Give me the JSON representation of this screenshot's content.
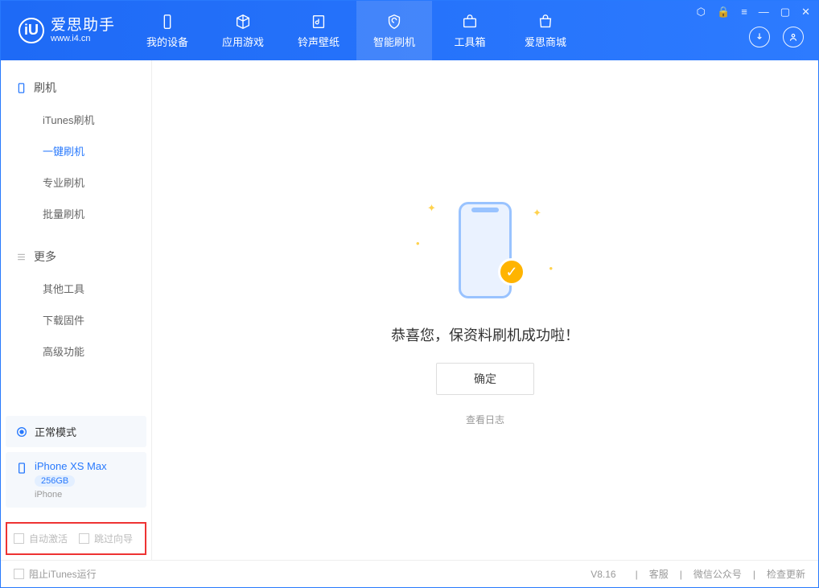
{
  "app": {
    "title": "爱思助手",
    "subtitle": "www.i4.cn"
  },
  "tabs": [
    {
      "label": "我的设备"
    },
    {
      "label": "应用游戏"
    },
    {
      "label": "铃声壁纸"
    },
    {
      "label": "智能刷机"
    },
    {
      "label": "工具箱"
    },
    {
      "label": "爱思商城"
    }
  ],
  "sidebar": {
    "section1": {
      "title": "刷机",
      "items": [
        "iTunes刷机",
        "一键刷机",
        "专业刷机",
        "批量刷机"
      ]
    },
    "section2": {
      "title": "更多",
      "items": [
        "其他工具",
        "下载固件",
        "高级功能"
      ]
    },
    "mode": "正常模式",
    "device": {
      "name": "iPhone XS Max",
      "storage": "256GB",
      "type": "iPhone"
    },
    "options": {
      "auto_activate": "自动激活",
      "skip_guide": "跳过向导"
    }
  },
  "main": {
    "success": "恭喜您，保资料刷机成功啦！",
    "ok": "确定",
    "view_log": "查看日志"
  },
  "footer": {
    "block_itunes": "阻止iTunes运行",
    "version": "V8.16",
    "links": [
      "客服",
      "微信公众号",
      "检查更新"
    ]
  }
}
